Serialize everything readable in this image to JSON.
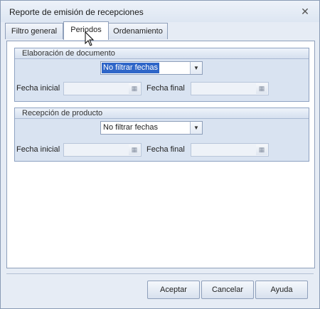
{
  "window": {
    "title": "Reporte de emisión de recepciones",
    "close_label": "✕"
  },
  "tabs": [
    {
      "label": "Filtro general"
    },
    {
      "label": "Periodos",
      "active": true
    },
    {
      "label": "Ordenamiento"
    }
  ],
  "groups": [
    {
      "title": "Elaboración de documento",
      "selected": "No filtrar fechas",
      "start_label": "Fecha inicial",
      "end_label": "Fecha final",
      "focused": true
    },
    {
      "title": "Recepción de producto",
      "selected": "No filtrar fechas",
      "start_label": "Fecha inicial",
      "end_label": "Fecha final",
      "focused": false
    }
  ],
  "buttons": {
    "accept": "Aceptar",
    "cancel": "Cancelar",
    "help": "Ayuda"
  },
  "icons": {
    "calendar": "calendar-icon",
    "dropdown": "chevron-down-icon",
    "close": "close-icon",
    "cursor": "mouse-pointer-icon"
  },
  "colors": {
    "selection": "#2f66c8",
    "group_bg": "#d9e3f1",
    "window_bg": "#e6ecf5"
  }
}
